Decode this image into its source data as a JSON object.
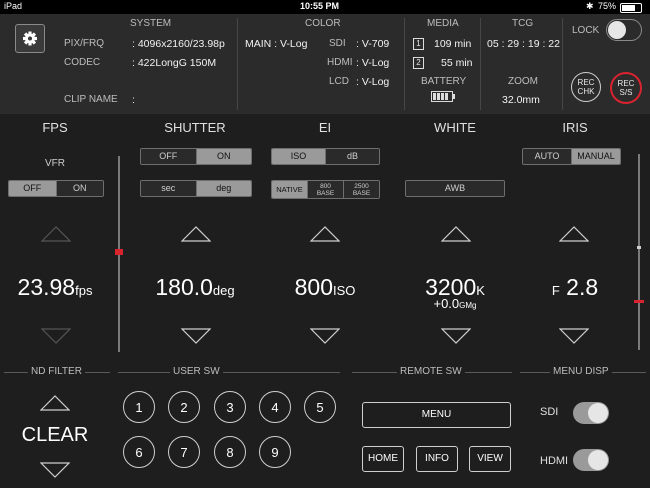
{
  "status": {
    "device": "iPad",
    "time": "10:55 PM",
    "battery": "75%"
  },
  "system": {
    "title": "SYSTEM",
    "pixfrq_label": "PIX/FRQ",
    "pixfrq_value": ": 4096x2160/23.98p",
    "codec_label": "CODEC",
    "codec_value": ": 422LongG 150M",
    "clip_label": "CLIP NAME",
    "clip_value": ":"
  },
  "color": {
    "title": "COLOR",
    "main": "MAIN : V-Log",
    "sdi_label": "SDI",
    "sdi_value": ": V-709",
    "hdmi_label": "HDMI",
    "hdmi_value": ": V-Log",
    "lcd_label": "LCD",
    "lcd_value": ": V-Log"
  },
  "media": {
    "title": "MEDIA",
    "slot1": "1",
    "slot1_value": "109 min",
    "slot2": "2",
    "slot2_value": "55 min",
    "battery_label": "BATTERY"
  },
  "tcg": {
    "title": "TCG",
    "value": "05 : 29 : 19 : 22",
    "zoom_label": "ZOOM",
    "zoom_value": "32.0mm"
  },
  "lock": {
    "label": "LOCK",
    "on": false
  },
  "rec_chk": {
    "line1": "REC",
    "line2": "CHK"
  },
  "rec_ss": {
    "line1": "REC",
    "line2": "S/S"
  },
  "fps": {
    "title": "FPS",
    "vfr": "VFR",
    "off": "OFF",
    "on": "ON",
    "value": "23.98",
    "unit": "fps"
  },
  "shutter": {
    "title": "SHUTTER",
    "off": "OFF",
    "on": "ON",
    "sec": "sec",
    "deg": "deg",
    "value": "180.0",
    "unit": "deg"
  },
  "ei": {
    "title": "EI",
    "iso": "ISO",
    "db": "dB",
    "native": "NATIVE",
    "b800a": "800",
    "b800b": "BASE",
    "b2500a": "2500",
    "b2500b": "BASE",
    "value": "800",
    "unit": "ISO"
  },
  "white": {
    "title": "WHITE",
    "awb": "AWB",
    "value": "3200",
    "unit": "K",
    "gmg_value": "+0.0",
    "gmg_unit": "GMg"
  },
  "iris": {
    "title": "IRIS",
    "auto": "AUTO",
    "manual": "MANUAL",
    "prefix": "F",
    "value": "2.8"
  },
  "nd": {
    "title": "ND FILTER",
    "value": "CLEAR"
  },
  "usersw": {
    "title": "USER SW",
    "buttons": [
      "1",
      "2",
      "3",
      "4",
      "5",
      "6",
      "7",
      "8",
      "9"
    ]
  },
  "remote": {
    "title": "REMOTE SW",
    "menu": "MENU",
    "home": "HOME",
    "info": "INFO",
    "view": "VIEW"
  },
  "menudisp": {
    "title": "MENU DISP",
    "sdi": "SDI",
    "hdmi": "HDMI"
  },
  "colors": {
    "accent_red": "#d9232e",
    "active_seg": "#9a9a9a"
  }
}
